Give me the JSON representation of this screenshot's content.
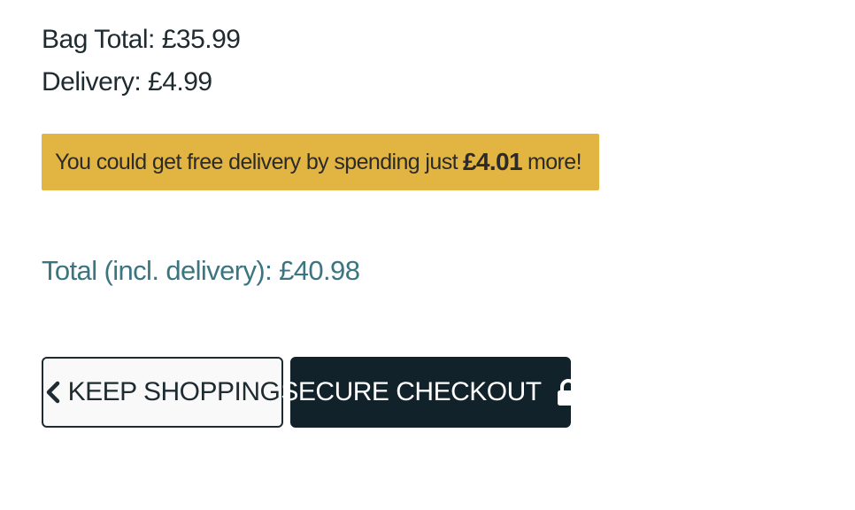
{
  "summary": {
    "bag_total": "Bag Total: £35.99",
    "delivery": "Delivery: £4.99"
  },
  "free_delivery_banner": {
    "prefix": "You could get free delivery by spending just",
    "amount": "£4.01",
    "suffix": "more!",
    "background_color": "#e2b442"
  },
  "grand_total": "Total (incl. delivery): £40.98",
  "buttons": {
    "keep_shopping": {
      "label": "KEEP SHOPPING",
      "icon": "chevron-left-icon"
    },
    "secure_checkout": {
      "label": "SECURE CHECKOUT",
      "icon": "lock-icon",
      "background_color": "#12222a"
    }
  },
  "colors": {
    "text_dark": "#1e2b30",
    "total_accent": "#3b7580"
  }
}
